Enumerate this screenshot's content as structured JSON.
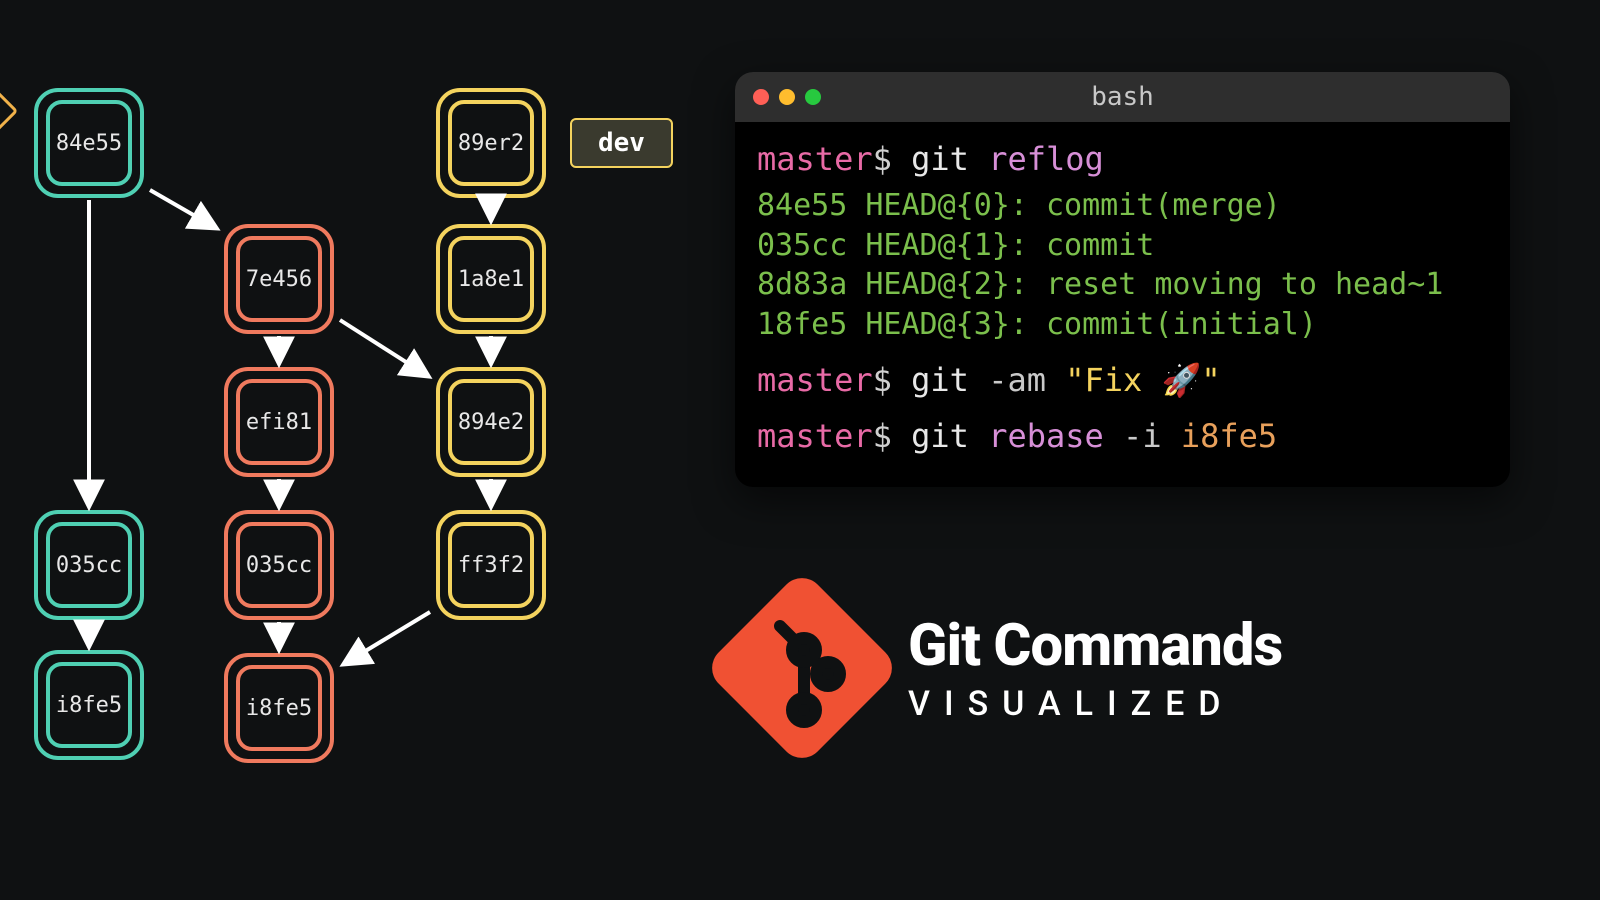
{
  "graph": {
    "branches": {
      "teal": [
        "84e55",
        "035cc",
        "i8fe5"
      ],
      "orange": [
        "7e456",
        "efi81",
        "035cc",
        "i8fe5"
      ],
      "yellow": [
        "89er2",
        "1a8e1",
        "894e2",
        "ff3f2"
      ]
    },
    "branch_tag": {
      "label": "dev",
      "for": "yellow"
    }
  },
  "terminal": {
    "title": "bash",
    "dots": [
      "close-dot",
      "minimize-dot",
      "zoom-dot"
    ],
    "commands": [
      {
        "prompt": "master",
        "dollar": "$",
        "parts": [
          {
            "t": "git ",
            "k": "cmd"
          },
          {
            "t": "reflog",
            "k": "sub"
          }
        ],
        "output": [
          "84e55 HEAD@{0}: commit(merge)",
          "035cc HEAD@{1}: commit",
          "8d83a HEAD@{2}: reset moving to head~1",
          "18fe5 HEAD@{3}: commit(initial)"
        ]
      },
      {
        "prompt": "master",
        "dollar": "$",
        "parts": [
          {
            "t": "git ",
            "k": "cmd"
          },
          {
            "t": "-am ",
            "k": "flag"
          },
          {
            "t": "\"Fix 🚀\"",
            "k": "str"
          }
        ]
      },
      {
        "prompt": "master",
        "dollar": "$",
        "parts": [
          {
            "t": "git ",
            "k": "cmd"
          },
          {
            "t": "rebase ",
            "k": "sub"
          },
          {
            "t": "-i ",
            "k": "flag"
          },
          {
            "t": "i8fe5",
            "k": "hash"
          }
        ]
      }
    ]
  },
  "title": {
    "line1": "Git Commands",
    "line2": "VISUALIZED"
  }
}
